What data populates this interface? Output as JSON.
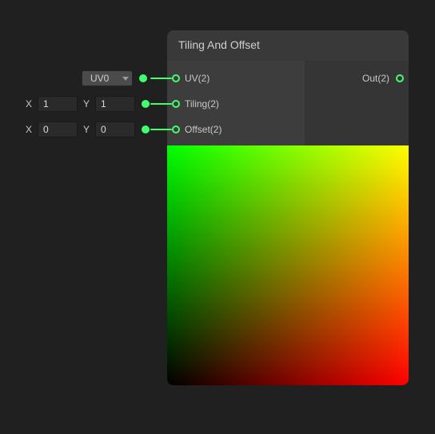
{
  "node": {
    "title": "Tiling And Offset",
    "inputs": [
      {
        "label": "UV(2)"
      },
      {
        "label": "Tiling(2)"
      },
      {
        "label": "Offset(2)"
      }
    ],
    "outputs": [
      {
        "label": "Out(2)"
      }
    ]
  },
  "uv_dropdown": {
    "selected": "UV0"
  },
  "tiling_vec": {
    "x_label": "X",
    "x_value": "1",
    "y_label": "Y",
    "y_value": "1"
  },
  "offset_vec": {
    "x_label": "X",
    "x_value": "0",
    "y_label": "Y",
    "y_value": "0"
  }
}
